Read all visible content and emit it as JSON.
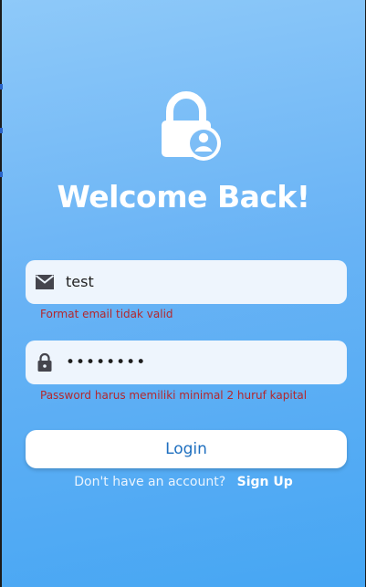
{
  "header": {
    "logo_icon": "lock-user-icon",
    "title": "Welcome Back!"
  },
  "email_field": {
    "icon": "mail-icon",
    "value": "test",
    "error": "Format email tidak valid"
  },
  "password_field": {
    "icon": "lock-icon",
    "value": "••••••••",
    "error": "Password harus memiliki minimal 2 huruf kapital"
  },
  "login_button": {
    "label": "Login"
  },
  "signup": {
    "prompt": "Don't have an account?",
    "link": "Sign Up"
  },
  "colors": {
    "gradient_top": "#8ec9f9",
    "gradient_bottom": "#46a6f3",
    "error": "#b3282d",
    "button_text": "#1e6fbf"
  }
}
